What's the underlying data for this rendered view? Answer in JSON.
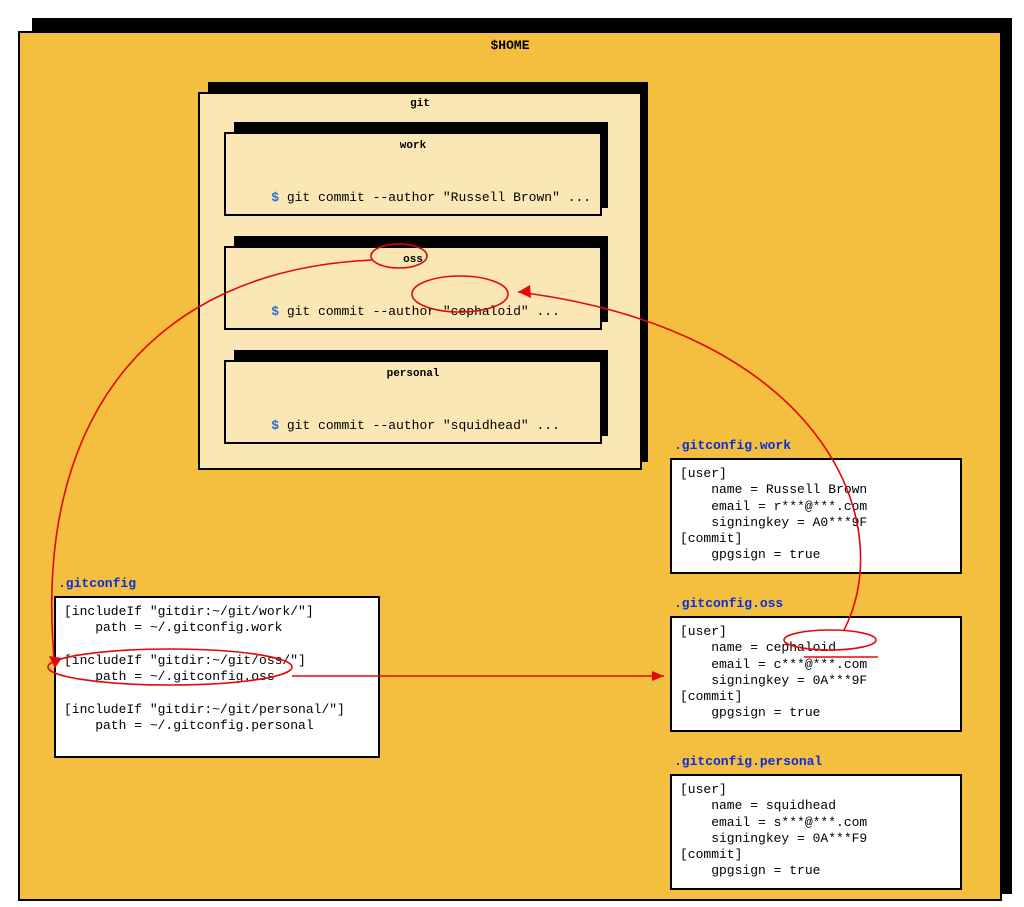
{
  "home": {
    "title": "$HOME",
    "git": {
      "title": "git",
      "dirs": [
        {
          "name": "work",
          "prompt": "$",
          "cmd_pre": " git commit --author \"",
          "cmd_author": "Russell Brown",
          "cmd_post": "\" ..."
        },
        {
          "name": "oss",
          "prompt": "$",
          "cmd_pre": " git commit --author \"",
          "cmd_author": "cephaloid",
          "cmd_post": "\" ..."
        },
        {
          "name": "personal",
          "prompt": "$",
          "cmd_pre": " git commit --author \"",
          "cmd_author": "squidhead",
          "cmd_post": "\" ..."
        }
      ]
    }
  },
  "gitconfig": {
    "title": ".gitconfig",
    "body": "[includeIf \"gitdir:~/git/work/\"]\n    path = ~/.gitconfig.work\n\n[includeIf \"gitdir:~/git/oss/\"]\n    path = ~/.gitconfig.oss\n\n[includeIf \"gitdir:~/git/personal/\"]\n    path = ~/.gitconfig.personal"
  },
  "files": {
    "work": {
      "title": ".gitconfig.work",
      "body": "[user]\n    name = Russell Brown\n    email = r***@***.com\n    signingkey = A0***9F\n[commit]\n    gpgsign = true"
    },
    "oss": {
      "title": ".gitconfig.oss",
      "body_pre": "[user]\n    name = ",
      "body_author": "cephaloid",
      "body_post": "\n    email = c***@***.com\n    signingkey = 0A***9F\n[commit]\n    gpgsign = true"
    },
    "personal": {
      "title": ".gitconfig.personal",
      "body": "[user]\n    name = squidhead\n    email = s***@***.com\n    signingkey = 0A***F9\n[commit]\n    gpgsign = true"
    }
  }
}
